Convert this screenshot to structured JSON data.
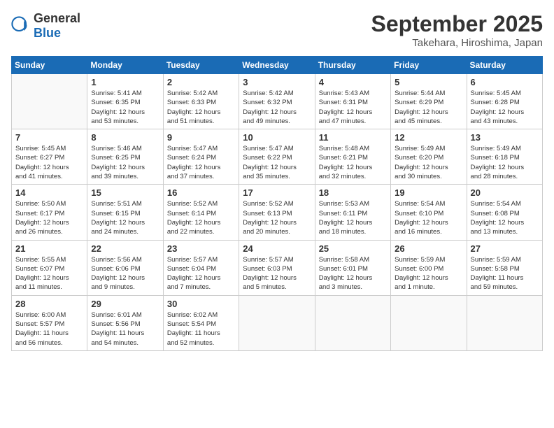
{
  "header": {
    "logo_general": "General",
    "logo_blue": "Blue",
    "month_title": "September 2025",
    "location": "Takehara, Hiroshima, Japan"
  },
  "days_of_week": [
    "Sunday",
    "Monday",
    "Tuesday",
    "Wednesday",
    "Thursday",
    "Friday",
    "Saturday"
  ],
  "weeks": [
    [
      {
        "day": "",
        "detail": ""
      },
      {
        "day": "1",
        "detail": "Sunrise: 5:41 AM\nSunset: 6:35 PM\nDaylight: 12 hours\nand 53 minutes."
      },
      {
        "day": "2",
        "detail": "Sunrise: 5:42 AM\nSunset: 6:33 PM\nDaylight: 12 hours\nand 51 minutes."
      },
      {
        "day": "3",
        "detail": "Sunrise: 5:42 AM\nSunset: 6:32 PM\nDaylight: 12 hours\nand 49 minutes."
      },
      {
        "day": "4",
        "detail": "Sunrise: 5:43 AM\nSunset: 6:31 PM\nDaylight: 12 hours\nand 47 minutes."
      },
      {
        "day": "5",
        "detail": "Sunrise: 5:44 AM\nSunset: 6:29 PM\nDaylight: 12 hours\nand 45 minutes."
      },
      {
        "day": "6",
        "detail": "Sunrise: 5:45 AM\nSunset: 6:28 PM\nDaylight: 12 hours\nand 43 minutes."
      }
    ],
    [
      {
        "day": "7",
        "detail": "Sunrise: 5:45 AM\nSunset: 6:27 PM\nDaylight: 12 hours\nand 41 minutes."
      },
      {
        "day": "8",
        "detail": "Sunrise: 5:46 AM\nSunset: 6:25 PM\nDaylight: 12 hours\nand 39 minutes."
      },
      {
        "day": "9",
        "detail": "Sunrise: 5:47 AM\nSunset: 6:24 PM\nDaylight: 12 hours\nand 37 minutes."
      },
      {
        "day": "10",
        "detail": "Sunrise: 5:47 AM\nSunset: 6:22 PM\nDaylight: 12 hours\nand 35 minutes."
      },
      {
        "day": "11",
        "detail": "Sunrise: 5:48 AM\nSunset: 6:21 PM\nDaylight: 12 hours\nand 32 minutes."
      },
      {
        "day": "12",
        "detail": "Sunrise: 5:49 AM\nSunset: 6:20 PM\nDaylight: 12 hours\nand 30 minutes."
      },
      {
        "day": "13",
        "detail": "Sunrise: 5:49 AM\nSunset: 6:18 PM\nDaylight: 12 hours\nand 28 minutes."
      }
    ],
    [
      {
        "day": "14",
        "detail": "Sunrise: 5:50 AM\nSunset: 6:17 PM\nDaylight: 12 hours\nand 26 minutes."
      },
      {
        "day": "15",
        "detail": "Sunrise: 5:51 AM\nSunset: 6:15 PM\nDaylight: 12 hours\nand 24 minutes."
      },
      {
        "day": "16",
        "detail": "Sunrise: 5:52 AM\nSunset: 6:14 PM\nDaylight: 12 hours\nand 22 minutes."
      },
      {
        "day": "17",
        "detail": "Sunrise: 5:52 AM\nSunset: 6:13 PM\nDaylight: 12 hours\nand 20 minutes."
      },
      {
        "day": "18",
        "detail": "Sunrise: 5:53 AM\nSunset: 6:11 PM\nDaylight: 12 hours\nand 18 minutes."
      },
      {
        "day": "19",
        "detail": "Sunrise: 5:54 AM\nSunset: 6:10 PM\nDaylight: 12 hours\nand 16 minutes."
      },
      {
        "day": "20",
        "detail": "Sunrise: 5:54 AM\nSunset: 6:08 PM\nDaylight: 12 hours\nand 13 minutes."
      }
    ],
    [
      {
        "day": "21",
        "detail": "Sunrise: 5:55 AM\nSunset: 6:07 PM\nDaylight: 12 hours\nand 11 minutes."
      },
      {
        "day": "22",
        "detail": "Sunrise: 5:56 AM\nSunset: 6:06 PM\nDaylight: 12 hours\nand 9 minutes."
      },
      {
        "day": "23",
        "detail": "Sunrise: 5:57 AM\nSunset: 6:04 PM\nDaylight: 12 hours\nand 7 minutes."
      },
      {
        "day": "24",
        "detail": "Sunrise: 5:57 AM\nSunset: 6:03 PM\nDaylight: 12 hours\nand 5 minutes."
      },
      {
        "day": "25",
        "detail": "Sunrise: 5:58 AM\nSunset: 6:01 PM\nDaylight: 12 hours\nand 3 minutes."
      },
      {
        "day": "26",
        "detail": "Sunrise: 5:59 AM\nSunset: 6:00 PM\nDaylight: 12 hours\nand 1 minute."
      },
      {
        "day": "27",
        "detail": "Sunrise: 5:59 AM\nSunset: 5:58 PM\nDaylight: 11 hours\nand 59 minutes."
      }
    ],
    [
      {
        "day": "28",
        "detail": "Sunrise: 6:00 AM\nSunset: 5:57 PM\nDaylight: 11 hours\nand 56 minutes."
      },
      {
        "day": "29",
        "detail": "Sunrise: 6:01 AM\nSunset: 5:56 PM\nDaylight: 11 hours\nand 54 minutes."
      },
      {
        "day": "30",
        "detail": "Sunrise: 6:02 AM\nSunset: 5:54 PM\nDaylight: 11 hours\nand 52 minutes."
      },
      {
        "day": "",
        "detail": ""
      },
      {
        "day": "",
        "detail": ""
      },
      {
        "day": "",
        "detail": ""
      },
      {
        "day": "",
        "detail": ""
      }
    ]
  ]
}
